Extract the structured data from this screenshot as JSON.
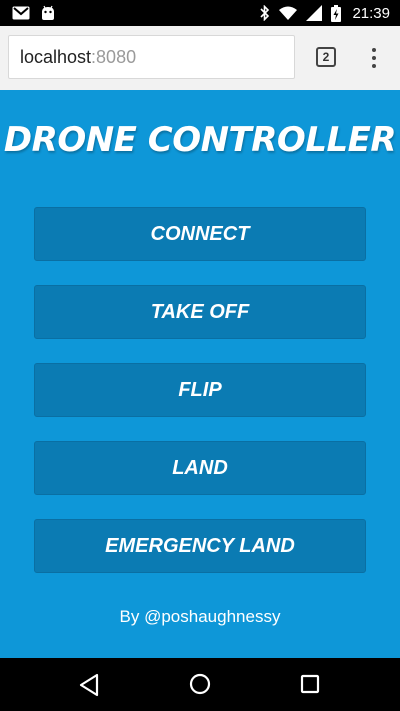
{
  "status_bar": {
    "time": "21:39",
    "icons": [
      "gmail-icon",
      "android-icon",
      "bluetooth-icon",
      "wifi-icon",
      "signal-icon",
      "battery-charging-icon"
    ]
  },
  "browser": {
    "url_host": "localhost",
    "url_port": ":8080",
    "tab_count": "2"
  },
  "page": {
    "title": "DRONE CONTROLLER",
    "buttons": {
      "connect": "CONNECT",
      "takeoff": "TAKE OFF",
      "flip": "FLIP",
      "land": "LAND",
      "emergency": "EMERGENCY LAND"
    },
    "credit": "By @poshaughnessy"
  },
  "colors": {
    "background": "#0e97d8",
    "button": "#0b7bb3",
    "text": "#ffffff"
  }
}
